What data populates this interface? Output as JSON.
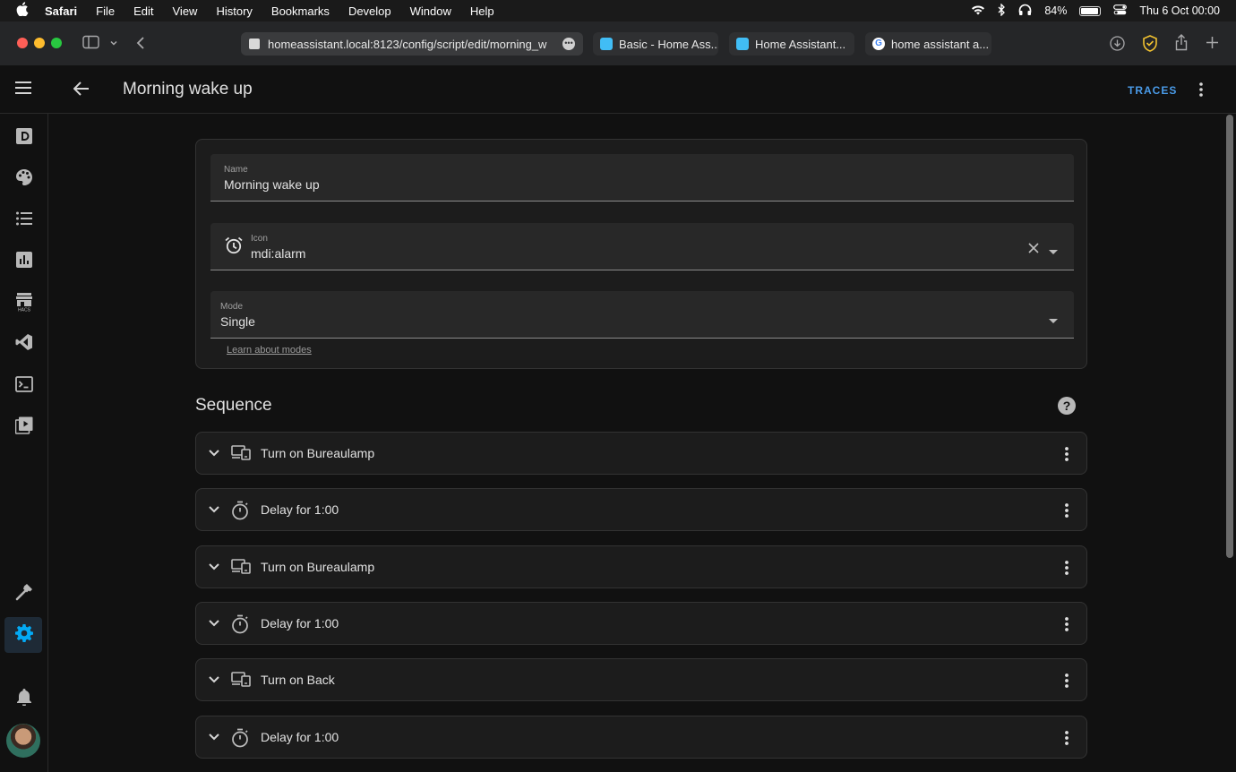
{
  "menubar": {
    "app": "Safari",
    "items": [
      "File",
      "Edit",
      "View",
      "History",
      "Bookmarks",
      "Develop",
      "Window",
      "Help"
    ],
    "battery": "84%",
    "datetime": "Thu 6 Oct  00:00"
  },
  "browser": {
    "url": "homeassistant.local:8123/config/script/edit/morning_w",
    "tabs": [
      "Basic - Home Ass...",
      "Home Assistant...",
      "home assistant a..."
    ],
    "traffic_colors": [
      "#ff5f57",
      "#febc2e",
      "#28c840"
    ]
  },
  "header": {
    "title": "Morning wake up",
    "traces_label": "TRACES"
  },
  "sidebar": {
    "items": [
      "dashboard-icon",
      "palette-icon",
      "list-icon",
      "chart-icon",
      "hacs-icon",
      "vscode-icon",
      "terminal-icon",
      "media-icon",
      "hammer-icon",
      "gear-icon",
      "bell-icon"
    ],
    "active": "gear-icon",
    "accent": "#03a9f4"
  },
  "form": {
    "name_label": "Name",
    "name_value": "Morning wake up",
    "icon_label": "Icon",
    "icon_value": "mdi:alarm",
    "mode_label": "Mode",
    "mode_value": "Single",
    "learn_link": "Learn about modes"
  },
  "sequence": {
    "title": "Sequence",
    "items": [
      {
        "label": "Turn on Bureaulamp",
        "icon": "devices-icon"
      },
      {
        "label": "Delay for 1:00",
        "icon": "timer-icon"
      },
      {
        "label": "Turn on Bureaulamp",
        "icon": "devices-icon"
      },
      {
        "label": "Delay for 1:00",
        "icon": "timer-icon"
      },
      {
        "label": "Turn on Back",
        "icon": "devices-icon"
      },
      {
        "label": "Delay for 1:00",
        "icon": "timer-icon"
      }
    ]
  }
}
